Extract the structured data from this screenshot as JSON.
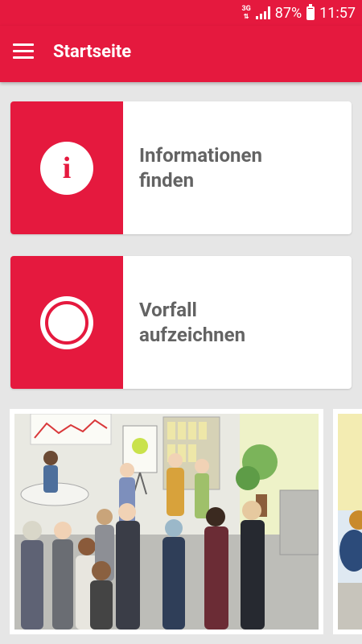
{
  "status_bar": {
    "network": "3G",
    "battery": "87%",
    "time": "11:57"
  },
  "app_bar": {
    "title": "Startseite"
  },
  "cards": [
    {
      "line1": "Informationen",
      "line2": "finden"
    },
    {
      "line1": "Vorfall",
      "line2": "aufzeichnen"
    }
  ],
  "illustrations": [
    "office-party-illustration",
    "partial-illustration"
  ],
  "colors": {
    "accent": "#e5193e",
    "background": "#e6e6e6",
    "card_text": "#636363"
  }
}
